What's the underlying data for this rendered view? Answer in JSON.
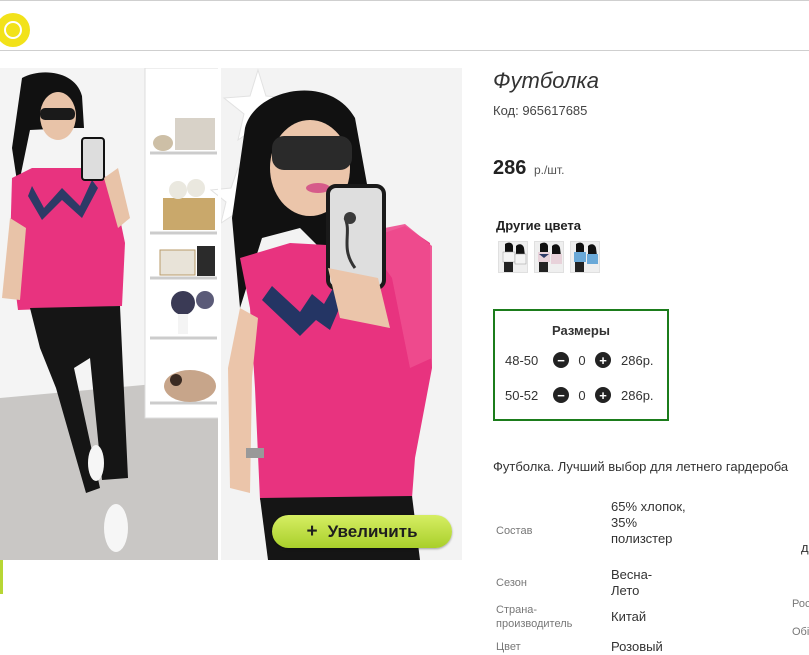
{
  "header": {
    "logo_icon": "sun-icon"
  },
  "product": {
    "title": "Футболка",
    "code": "Код: 965617685",
    "price": "286",
    "price_unit": "р./шт.",
    "zoom_button": {
      "icon": "plus-icon",
      "label": "Увеличить"
    }
  },
  "colors": {
    "heading": "Другие цвета",
    "thumbs": [
      {
        "name": "color-white",
        "shirt": "#f4f4f4"
      },
      {
        "name": "color-pink",
        "shirt": "#e8d2da"
      },
      {
        "name": "color-blue",
        "shirt": "#6aa9d8"
      }
    ]
  },
  "sizes": {
    "heading": "Размеры",
    "rows": [
      {
        "size": "48-50",
        "qty": "0",
        "price": "286р."
      },
      {
        "size": "50-52",
        "qty": "0",
        "price": "286р."
      }
    ]
  },
  "description": "Футболка. Лучший выбор для летнего гардероба",
  "specs": [
    {
      "label": "Состав",
      "value": "65% хлопок, 35% полизстер"
    },
    {
      "label": "Сезон",
      "value": "Весна-Лето"
    },
    {
      "label": "Страна-производитель",
      "value": "Китай"
    },
    {
      "label": "Цвет",
      "value": "Розовый"
    }
  ],
  "right_clipped": [
    "д",
    "Рос",
    "Обі"
  ],
  "colors_theme": {
    "accent_green": "#1b7c1b",
    "button_green": "#b7d634",
    "shirt_pink": "#e8337f"
  }
}
